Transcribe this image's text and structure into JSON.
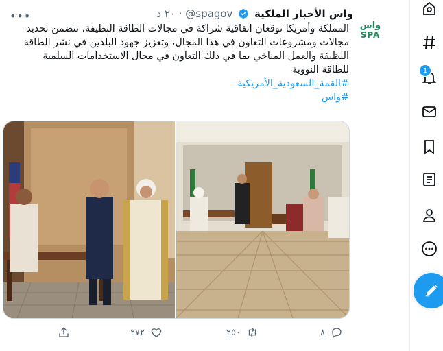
{
  "tweet": {
    "account_name": "واس الأخبار الملكية",
    "handle": "@spagov",
    "separator": "·",
    "time": "٢٠ د",
    "avatar_top": "واس",
    "avatar_bottom": "SPA",
    "text_lines": [
      "المملكة وأمريكا توقعان  اتفاقية شراكة في مجالات الطاقة النظيفة، تتضمن تحديد",
      "مجالات ومشروعات التعاون في هذا المجال، وتعزيز جهود البلدين في نشر الطاقة",
      "النظيفة والعمل المناخي بما في ذلك التعاون في مجال الاستخدامات السلمية",
      "للطاقة النووية"
    ],
    "hashtags": [
      "#القمة_السعودية_الأمريكية",
      "#واس"
    ],
    "actions": {
      "replies": "٨",
      "retweets": "٢٥٠",
      "likes": "٢٧٢",
      "share": ""
    }
  },
  "colors": {
    "accent": "#1d9bf0",
    "muted": "#536471",
    "brand_green": "#1f8a5b"
  },
  "nav_rail": {
    "icons": [
      "explore-icon",
      "hashtag-icon",
      "notifications-icon",
      "messages-icon",
      "bookmarks-icon",
      "lists-icon",
      "profile-icon",
      "more-icon",
      "compose-tweet-icon"
    ],
    "notification_badge": "1"
  }
}
